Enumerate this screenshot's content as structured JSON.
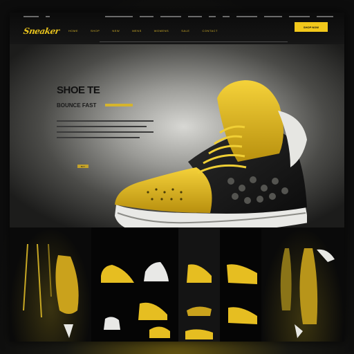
{
  "brand": {
    "logo_text": "Sneaker"
  },
  "nav": {
    "links": [
      "HOME",
      "SHOP",
      "NEW",
      "MENS",
      "WOMENS",
      "SALE",
      "CONTACT"
    ],
    "cta_label": "SHOP NOW"
  },
  "hero": {
    "title": "SHOE TE",
    "subtitle": "BOUNCE FAST",
    "cta_label": "BUY"
  },
  "gallery": {
    "panels": [
      "apparel",
      "sneakers",
      "sneakers",
      "sneakers",
      "apparel"
    ]
  },
  "colors": {
    "accent": "#f2c81b",
    "dark": "#111111",
    "hero_light": "#d8d8d4"
  },
  "icons": [
    "sneaker-icon"
  ]
}
